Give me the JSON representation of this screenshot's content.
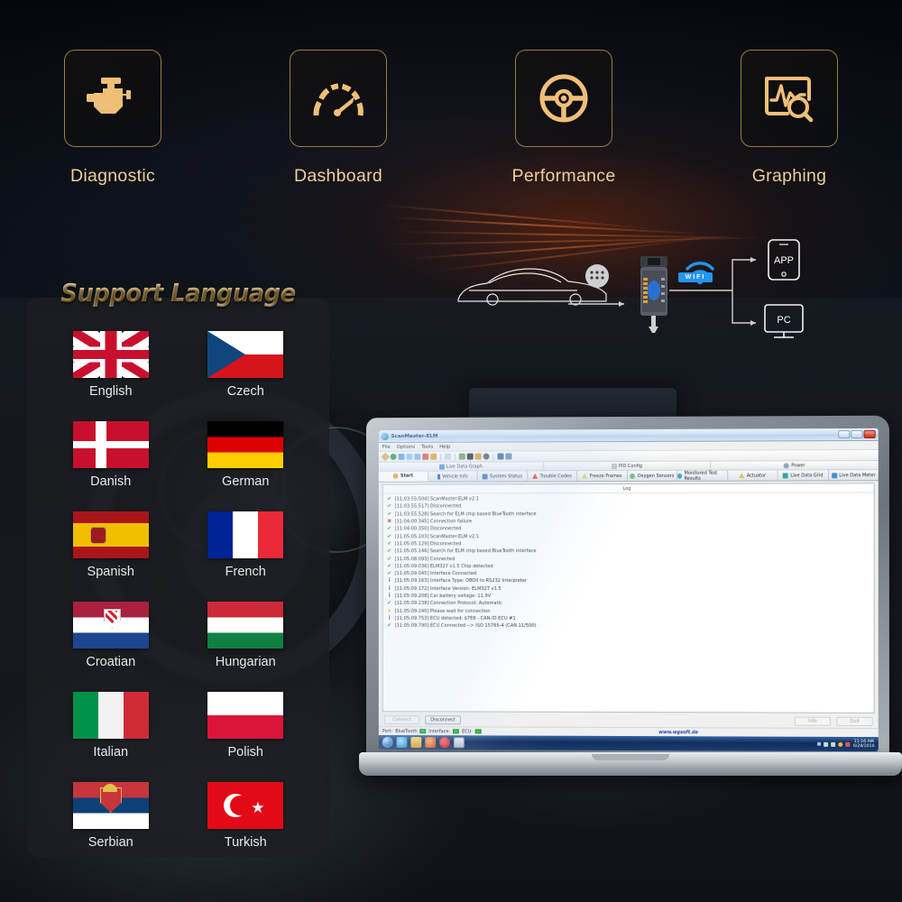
{
  "features": [
    {
      "label": "Diagnostic",
      "icon": "engine-check-icon"
    },
    {
      "label": "Dashboard",
      "icon": "gauge-icon"
    },
    {
      "label": "Performance",
      "icon": "steering-wheel-icon"
    },
    {
      "label": "Graphing",
      "icon": "graph-search-icon"
    }
  ],
  "language_panel": {
    "title": "Support Language",
    "languages": [
      {
        "name": "English",
        "flag": "flag-uk"
      },
      {
        "name": "Czech",
        "flag": "flag-czech"
      },
      {
        "name": "Danish",
        "flag": "flag-denmark"
      },
      {
        "name": "German",
        "flag": "flag-germany"
      },
      {
        "name": "Spanish",
        "flag": "flag-spain"
      },
      {
        "name": "French",
        "flag": "flag-france"
      },
      {
        "name": "Croatian",
        "flag": "flag-croatia"
      },
      {
        "name": "Hungarian",
        "flag": "flag-hungary"
      },
      {
        "name": "Italian",
        "flag": "flag-italy"
      },
      {
        "name": "Polish",
        "flag": "flag-poland"
      },
      {
        "name": "Serbian",
        "flag": "flag-serbia"
      },
      {
        "name": "Turkish",
        "flag": "flag-turkey"
      }
    ]
  },
  "diagram": {
    "car": "car-icon",
    "obd_port": "obd-dots-icon",
    "adapter": "elm327-adapter-icon",
    "wifi_label": "WIFI",
    "app_label": "APP",
    "pc_label": "PC"
  },
  "app": {
    "window_title": "ScanMaster-ELM",
    "window_buttons": {
      "minimize": "–",
      "maximize": "☐",
      "close": "✕"
    },
    "menu": [
      "File",
      "Options",
      "Tools",
      "Help"
    ],
    "toolbar_icons": [
      "wrench-icon",
      "globe-icon",
      "report-icon",
      "table-icon",
      "grid-icon",
      "chart-icon",
      "flame-icon",
      "copy-icon",
      "tag-icon",
      "stop-icon",
      "battery-icon",
      "sensor-icon",
      "usb-icon",
      "printer-icon"
    ],
    "top_tabs": [
      {
        "label": "Live Data Graph",
        "icon": "graph-icon"
      },
      {
        "label": "PID Config",
        "icon": "config-icon"
      },
      {
        "label": "Power",
        "icon": "power-icon"
      }
    ],
    "tabs": [
      {
        "label": "Start",
        "icon": "start-icon",
        "active": true
      },
      {
        "label": "Vehicle Info",
        "icon": "info-icon",
        "active": false
      },
      {
        "label": "System Status",
        "icon": "status-icon",
        "active": false
      },
      {
        "label": "Trouble Codes",
        "icon": "warning-icon",
        "active": false
      },
      {
        "label": "Freeze Frames",
        "icon": "freeze-icon",
        "active": false
      },
      {
        "label": "Oxygen Sensors",
        "icon": "oxygen-icon",
        "active": false
      },
      {
        "label": "Monitored Test Results",
        "icon": "test-icon",
        "active": false
      },
      {
        "label": "Actuator",
        "icon": "actuator-icon",
        "active": false
      },
      {
        "label": "Live Data Grid",
        "icon": "grid-icon",
        "active": false
      },
      {
        "label": "Live Data Meter",
        "icon": "meter-icon",
        "active": false
      }
    ],
    "content_header": "Log",
    "log": [
      {
        "status": "ok",
        "glyph": "✔",
        "text": "[11:03:55.504] ScanMaster-ELM v2.1"
      },
      {
        "status": "ok",
        "glyph": "✔",
        "text": "[11:03:55.517] Disconnected"
      },
      {
        "status": "ok",
        "glyph": "✔",
        "text": "[11:03:55.528] Search for ELM chip based BlueTooth interface"
      },
      {
        "status": "error",
        "glyph": "✖",
        "text": "[11:04:00.345] Connection failure"
      },
      {
        "status": "ok",
        "glyph": "✔",
        "text": "[11:04:00.350] Disconnected"
      },
      {
        "status": "ok",
        "glyph": "✔",
        "text": "[11:05:05.103] ScanMaster-ELM v2.1"
      },
      {
        "status": "ok",
        "glyph": "✔",
        "text": "[11:05:05.129] Disconnected"
      },
      {
        "status": "ok",
        "glyph": "✔",
        "text": "[11:05:05.146] Search for ELM chip based BlueTooth interface"
      },
      {
        "status": "ok",
        "glyph": "✔",
        "text": "[11:05:08.093] Connected"
      },
      {
        "status": "ok",
        "glyph": "✔",
        "text": "[11:05:09.036] ELM327 v1.5 Chip detected"
      },
      {
        "status": "ok",
        "glyph": "✔",
        "text": "[11:05:09.045] Interface Connected"
      },
      {
        "status": "info",
        "glyph": "i",
        "text": "[11:05:09.163] Interface Type: OBDII to RS232 Interpreter"
      },
      {
        "status": "info",
        "glyph": "i",
        "text": "[11:05:09.172] Interface Version: ELM327 v1.5"
      },
      {
        "status": "info",
        "glyph": "i",
        "text": "[11:05:09.208] Car battery voltage: 11.9V"
      },
      {
        "status": "ok",
        "glyph": "✔",
        "text": "[11:05:09.238] Connection Protocol: Automatic"
      },
      {
        "status": "warn",
        "glyph": "➤",
        "text": "[11:05:09.240] Please wait for connection"
      },
      {
        "status": "info",
        "glyph": "i",
        "text": "[11:05:09.753] ECU detected: $7E8 - CAN-ID ECU #1"
      },
      {
        "status": "ok",
        "glyph": "✔",
        "text": "[11:05:09.790] ECU Connected --> ISO 15765-4 (CAN 11/500)"
      }
    ],
    "buttons": {
      "connect": "Connect",
      "disconnect": "Disconnect",
      "info": "Info",
      "quit": "Quit"
    },
    "status_bar": {
      "port_label": "Port:",
      "port_value": "BlueTooth",
      "interface_label": "Interface:",
      "ecu_label": "ECU:",
      "website": "www.wgsoft.de"
    },
    "taskbar": {
      "time": "11:16 AM",
      "date": "6/28/2016"
    }
  },
  "colors": {
    "gold": "#efbf78",
    "gold_text": "#edcf9a",
    "panel_bg": "#1c1e22",
    "accent_blue": "#2196f3",
    "ok_green": "#2aa02a",
    "error_red": "#d32f2f"
  }
}
